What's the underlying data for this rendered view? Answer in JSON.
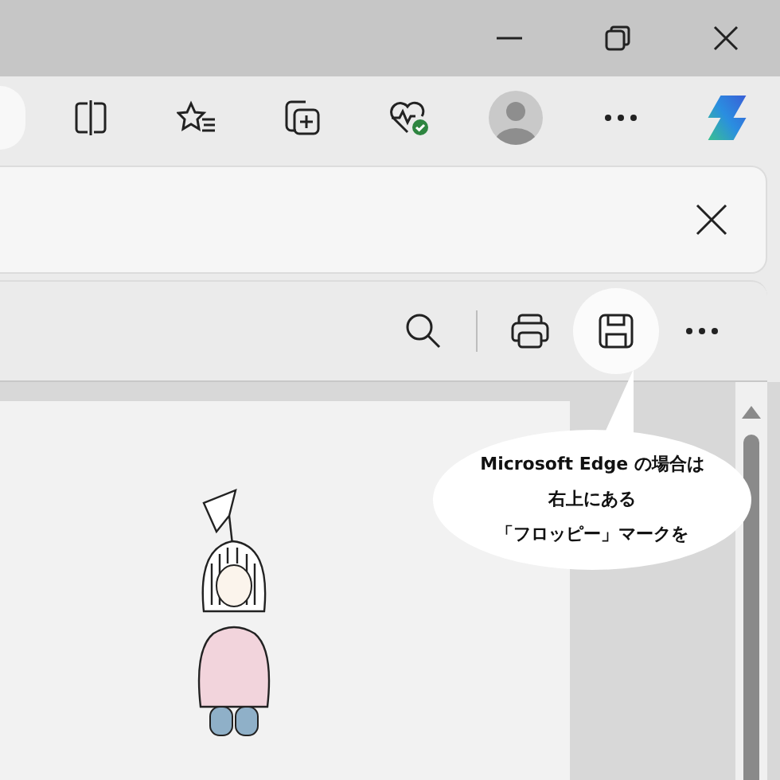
{
  "window_controls": [
    {
      "kind": "minimize"
    },
    {
      "kind": "restore"
    },
    {
      "kind": "close"
    }
  ],
  "toolbar": [
    {
      "kind": "split-screen"
    },
    {
      "kind": "favorites"
    },
    {
      "kind": "collections"
    },
    {
      "kind": "browser-essentials"
    },
    {
      "kind": "profile"
    },
    {
      "kind": "more"
    },
    {
      "kind": "copilot"
    }
  ],
  "pdf_toolbar": [
    {
      "kind": "search",
      "selected": false
    },
    {
      "kind": "divider"
    },
    {
      "kind": "print",
      "selected": false
    },
    {
      "kind": "save",
      "selected": true
    },
    {
      "kind": "more",
      "selected": false
    }
  ],
  "callout": {
    "lines": [
      "Microsoft Edge の場合は",
      "右上にある",
      "「フロッピー」マークを"
    ]
  }
}
